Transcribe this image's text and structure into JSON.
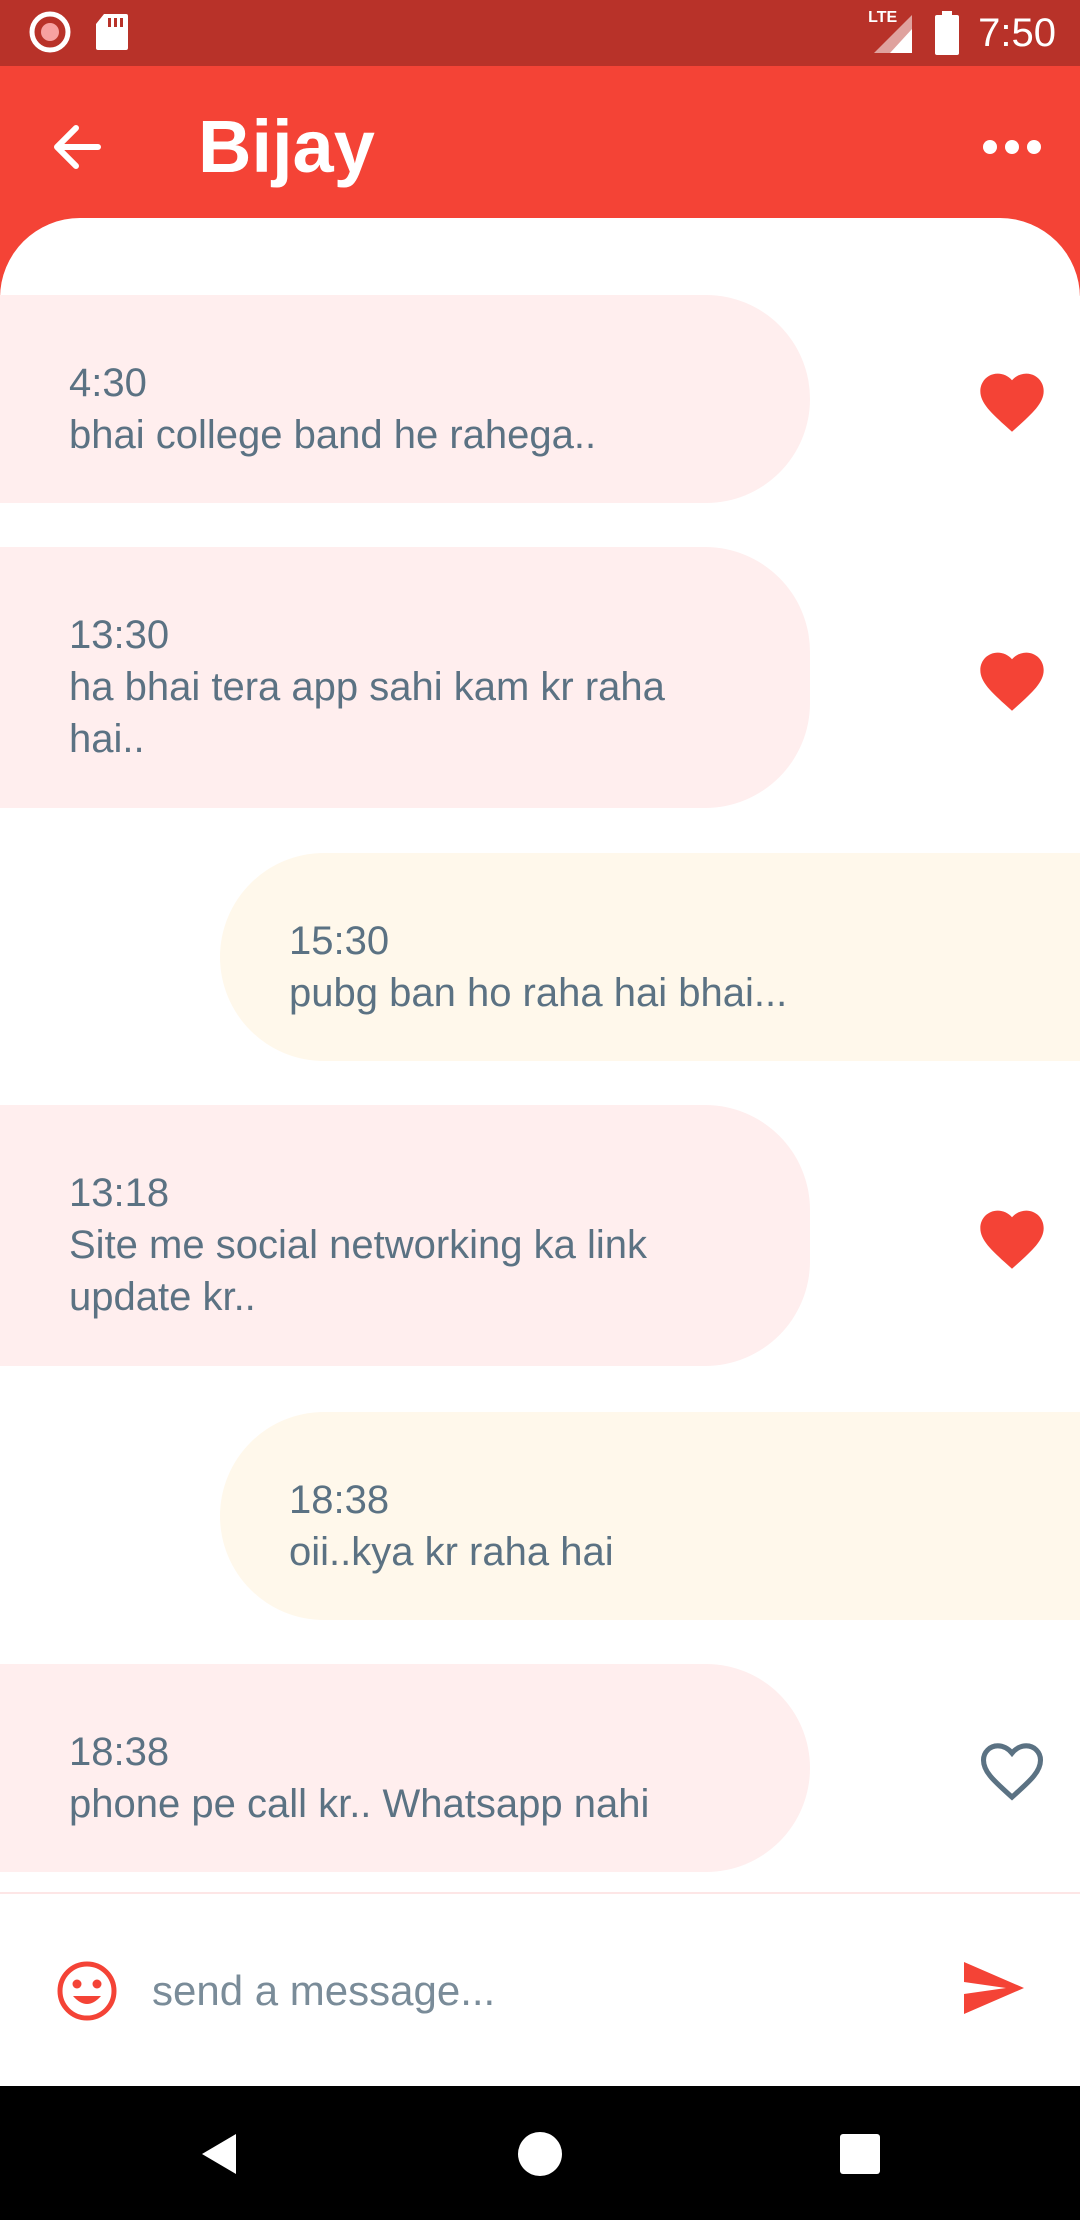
{
  "status_bar": {
    "time": "7:50",
    "network": "LTE",
    "icons": [
      "record-icon",
      "sd-card-icon",
      "signal-icon",
      "battery-icon"
    ]
  },
  "app_bar": {
    "title": "Bijay",
    "back_icon": "arrow-left-icon",
    "more_icon": "more-horizontal-icon"
  },
  "messages": [
    {
      "type": "received",
      "time": "4:30",
      "text": "bhai college band he rahega..",
      "liked": true
    },
    {
      "type": "received",
      "time": "13:30",
      "text": "ha bhai tera app sahi kam kr raha hai..",
      "liked": true
    },
    {
      "type": "sent",
      "time": "15:30",
      "text": "pubg ban ho raha hai bhai..."
    },
    {
      "type": "received",
      "time": "13:18",
      "text": "Site me social networking ka link update kr..",
      "liked": true
    },
    {
      "type": "sent",
      "time": "18:38",
      "text": "oii..kya kr raha hai"
    },
    {
      "type": "received",
      "time": "18:38",
      "text": "phone pe call kr.. Whatsapp nahi",
      "liked": false
    }
  ],
  "composer": {
    "placeholder": "send a message...",
    "emoji_icon": "smiley-icon",
    "send_icon": "send-icon"
  },
  "nav_bar": {
    "icons": [
      "back-triangle-icon",
      "home-circle-icon",
      "recents-square-icon"
    ]
  },
  "colors": {
    "primary": "#f44336",
    "status_bar": "#b83229",
    "received_bubble": "#ffeeee",
    "sent_bubble": "#fff8eb",
    "text": "#5b7283",
    "like_off": "#5b7283"
  }
}
